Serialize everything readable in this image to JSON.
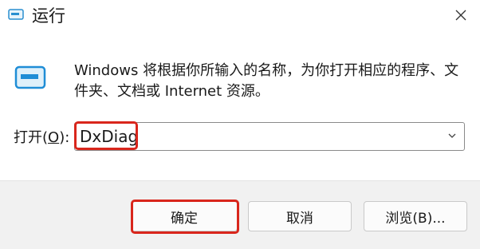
{
  "window": {
    "title": "运行",
    "close_icon": "close-icon",
    "app_icon": "run-dialog-icon"
  },
  "description": {
    "line1": "Windows 将根据你所输入的名称，为你打开相应的程序、文",
    "line2": "件夹、文档或 Internet 资源。"
  },
  "open_field": {
    "label_prefix": "打开(",
    "label_accel": "O",
    "label_suffix": "):",
    "value": "DxDiag",
    "chevron_icon": "chevron-down-icon"
  },
  "buttons": {
    "ok": "确定",
    "cancel": "取消",
    "browse": "浏览(B)..."
  },
  "annotations": {
    "highlight_color": "#d9261c"
  }
}
